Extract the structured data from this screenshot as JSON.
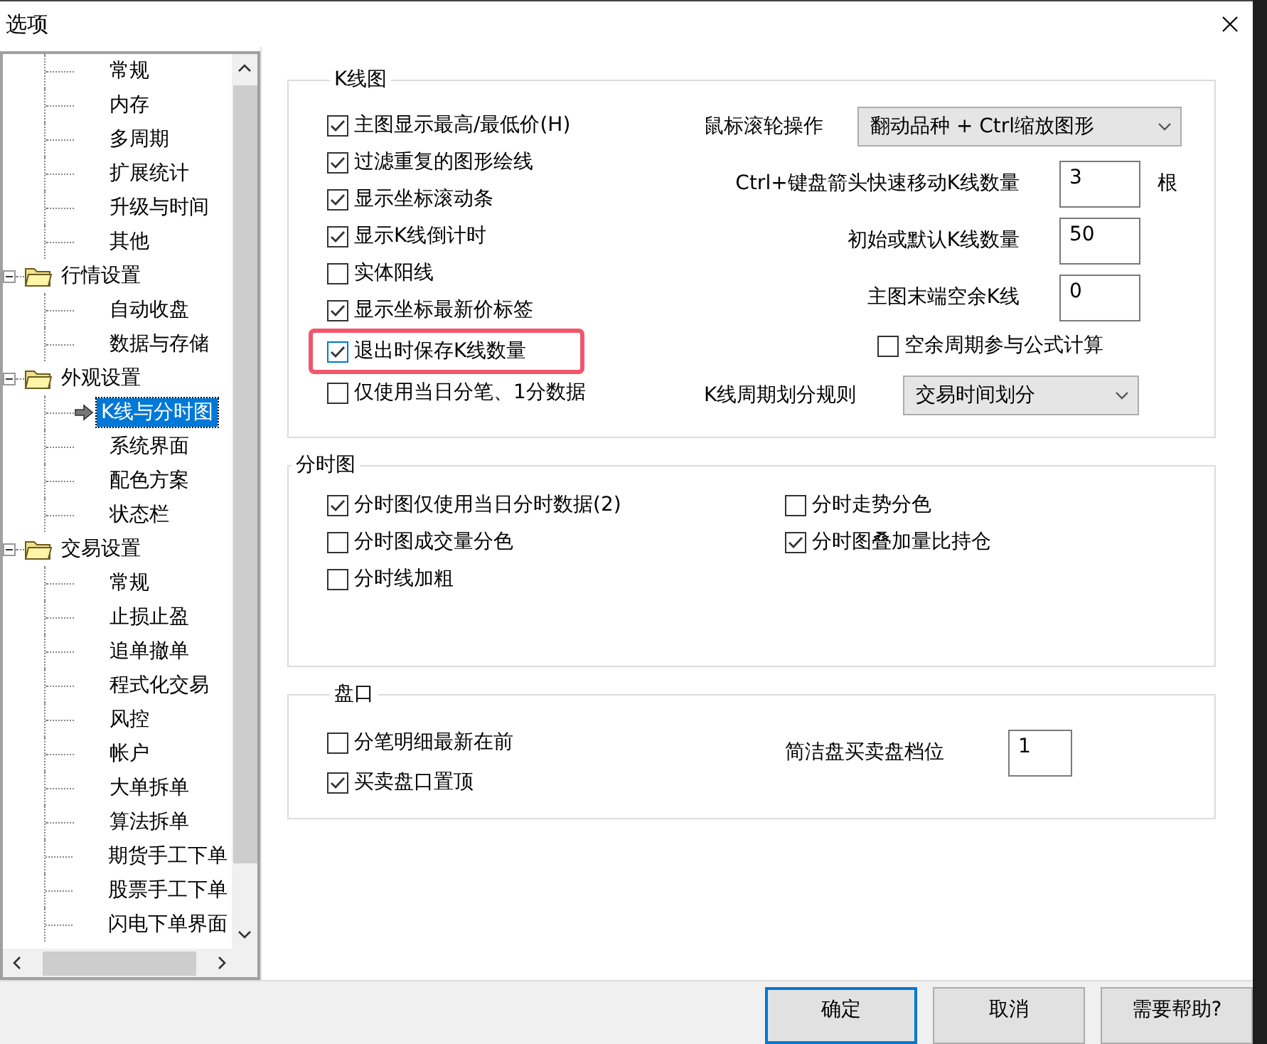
{
  "window": {
    "title": "选项"
  },
  "tree": [
    {
      "children": [
        {
          "label": "常规",
          "selected": false
        },
        {
          "label": "内存",
          "selected": false
        },
        {
          "label": "多周期",
          "selected": false
        },
        {
          "label": "扩展统计",
          "selected": false
        },
        {
          "label": "升级与时间",
          "selected": false
        },
        {
          "label": "其他",
          "selected": false
        }
      ]
    },
    {
      "label": "行情设置",
      "expanded": true,
      "children": [
        {
          "label": "自动收盘",
          "selected": false
        },
        {
          "label": "数据与存储",
          "selected": false
        }
      ]
    },
    {
      "label": "外观设置",
      "expanded": true,
      "children": [
        {
          "label": "K线与分时图",
          "selected": true
        },
        {
          "label": "系统界面",
          "selected": false
        },
        {
          "label": "配色方案",
          "selected": false
        },
        {
          "label": "状态栏",
          "selected": false
        }
      ]
    },
    {
      "label": "交易设置",
      "expanded": true,
      "children": [
        {
          "label": "常规",
          "selected": false
        },
        {
          "label": "止损止盈",
          "selected": false
        },
        {
          "label": "追单撤单",
          "selected": false
        },
        {
          "label": "程式化交易",
          "selected": false
        },
        {
          "label": "风控",
          "selected": false
        },
        {
          "label": "帐户",
          "selected": false
        },
        {
          "label": "大单拆单",
          "selected": false
        },
        {
          "label": "算法拆单",
          "selected": false
        },
        {
          "label": "期货手工下单",
          "selected": false
        },
        {
          "label": "股票手工下单",
          "selected": false
        },
        {
          "label": "闪电下单界面",
          "selected": false
        }
      ]
    }
  ],
  "kline": {
    "title": "K线图",
    "options": [
      {
        "label": "主图显示最高/最低价(H)",
        "checked": true,
        "highlighted": false
      },
      {
        "label": "过滤重复的图形绘线",
        "checked": true,
        "highlighted": false
      },
      {
        "label": "显示坐标滚动条",
        "checked": true,
        "highlighted": false
      },
      {
        "label": "显示K线倒计时",
        "checked": true,
        "highlighted": false
      },
      {
        "label": "实体阳线",
        "checked": false,
        "highlighted": false
      },
      {
        "label": "显示坐标最新价标签",
        "checked": true,
        "highlighted": false
      },
      {
        "label": "退出时保存K线数量",
        "checked": true,
        "highlighted": true
      },
      {
        "label": "仅使用当日分笔、1分数据",
        "checked": false,
        "highlighted": false
      }
    ],
    "fields": [
      {
        "kind": "select",
        "label": "鼠标滚轮操作",
        "value": "翻动品种 + Ctrl缩放图形"
      },
      {
        "kind": "number",
        "label": "Ctrl+键盘箭头快速移动K线数量",
        "value": "3",
        "unit": "根"
      },
      {
        "kind": "number",
        "label": "初始或默认K线数量",
        "value": "50"
      },
      {
        "kind": "number",
        "label": "主图末端空余K线",
        "value": "0"
      },
      {
        "kind": "checkbox",
        "label": "空余周期参与公式计算",
        "checked": false
      },
      {
        "kind": "select",
        "label": "K线周期划分规则",
        "value": "交易时间划分"
      }
    ]
  },
  "timeshare": {
    "title": "分时图",
    "options": [
      {
        "label": "分时图仅使用当日分时数据(2)",
        "checked": true
      },
      {
        "label": "分时走势分色",
        "checked": false
      },
      {
        "label": "分时图成交量分色",
        "checked": false
      },
      {
        "label": "分时图叠加量比持仓",
        "checked": true
      },
      {
        "label": "分时线加粗",
        "checked": false
      }
    ]
  },
  "orderbook": {
    "title": "盘口",
    "options": [
      {
        "label": "分笔明细最新在前",
        "checked": false
      },
      {
        "label": "买卖盘口置顶",
        "checked": true
      }
    ],
    "field": {
      "label": "简洁盘买卖盘档位",
      "value": "1"
    }
  },
  "buttons": [
    {
      "label": "确定",
      "default": true
    },
    {
      "label": "取消",
      "default": false
    },
    {
      "label": "需要帮助?",
      "default": false
    }
  ]
}
